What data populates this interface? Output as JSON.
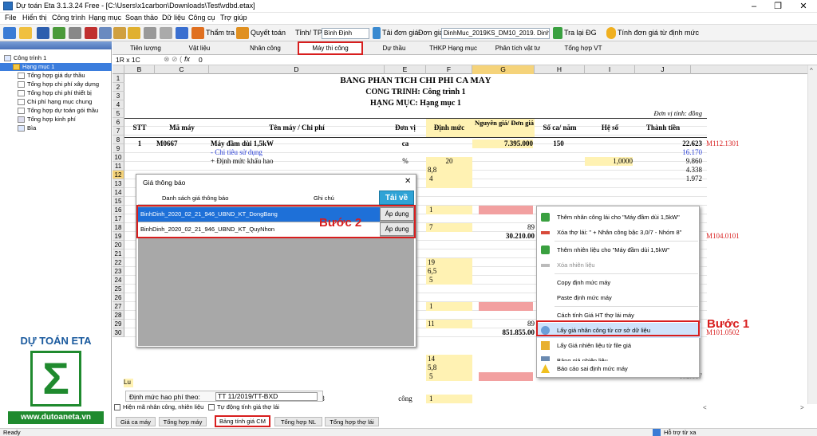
{
  "window": {
    "title": "Dự toán Eta 3.1.3.24 Free - [C:\\Users\\x1carbon\\Downloads\\Test\\vdbd.etax]",
    "min": "–",
    "max": "❐",
    "close": "✕"
  },
  "menu": [
    "File",
    "Hiển thị",
    "Công trình",
    "Hạng mục",
    "Soạn thảo",
    "Dữ liệu",
    "Công cụ",
    "Trợ giúp"
  ],
  "toolbar": {
    "tham_tra": "Thẩm tra",
    "quyet_toan": "Quyết toán",
    "tinh_label": "Tỉnh/ TP:",
    "tinh_value": "Bình Định",
    "tai_don_gia": "Tải đơn giá",
    "don_gia_label": "Đơn giá:",
    "don_gia_value": "DinhMuc_2019KS_DM10_2019. DinhMuc",
    "tra_lai_dg": "Tra lại ĐG",
    "tinh_don_gia": "Tính đơn giá từ định mức"
  },
  "sidebar": {
    "items": [
      "Công trình 1",
      "Hạng mục 1",
      "Tổng hợp giá dự thầu",
      "Tổng hợp chi phí xây dựng",
      "Tổng hợp chi phí thiết bị",
      "Chi phí hạng mục chung",
      "Tổng hợp dự toán gói thầu",
      "Tổng hợp kinh phí",
      "Bìa"
    ],
    "logo_top": "DỰ TOÁN ETA",
    "logo_bottom": "www.dutoaneta.vn",
    "logo_symbol": "Σ"
  },
  "tabs": [
    "Tiên lượng",
    "Vật liệu",
    "Nhân công",
    "Máy thi công",
    "Dự thầu",
    "THKP Hạng mục",
    "Phân tích vật tư",
    "Tổng hợp VT"
  ],
  "formula": {
    "cellref": "1R x 1C",
    "fx": "fx",
    "value": "0"
  },
  "columns": [
    "B",
    "C",
    "D",
    "E",
    "F",
    "G",
    "H",
    "I",
    "J"
  ],
  "rows": [
    "1",
    "2",
    "3",
    "4",
    "5",
    "6",
    "7",
    "8",
    "9",
    "10",
    "11",
    "12",
    "13",
    "14",
    "15",
    "16",
    "17",
    "18",
    "19",
    "20",
    "21",
    "22",
    "23",
    "24",
    "25",
    "26",
    "27",
    "28",
    "29",
    "30"
  ],
  "sheet": {
    "title": "BẢNG PHÂN TÍCH CHI PHÍ CA MÁY",
    "subtitle1": "CÔNG TRÌNH: Công trình 1",
    "subtitle2": "HẠNG MỤC: Hạng mục 1",
    "unit": "Đơn vị tính: đồng",
    "headers": {
      "stt": "STT",
      "ma": "Mã máy",
      "ten": "Tên máy / Chi phí",
      "dv": "Đơn vị",
      "dm": "Định mức",
      "ng": "Nguyên giá/ Đơn giá",
      "sc": "Số ca/ năm",
      "hs": "Hệ số",
      "tt": "Thành tiền"
    },
    "r6": {
      "stt": "1",
      "ma": "M0667",
      "ten": "Máy đầm dùi 1,5kW",
      "dv": "ca",
      "ng": "7.395.000",
      "sc": "150",
      "tt": "22.623",
      "note": "M112.1301"
    },
    "r7": {
      "ten": "- Chi tiêu sử dụng",
      "tt": "16.170"
    },
    "r8": {
      "ten": "+ Định mức khấu hao",
      "dv": "%",
      "dm": "20",
      "hs": "1,0000",
      "tt": "9.860"
    },
    "r9": {
      "dm": "8,8",
      "tt": "4.338"
    },
    "r10": {
      "dm": "4",
      "tt": "1.972"
    },
    "r12": {
      "dm": "1"
    },
    "r14": {
      "dm": "7",
      "ng": "89"
    },
    "r15": {
      "ng": "30.210.00",
      "tt": "4",
      "note": "M104.0101"
    },
    "r17": {
      "dm": "19"
    },
    "r18": {
      "dm": "6,5"
    },
    "r19": {
      "dm": "5"
    },
    "r21": {
      "dm": "1"
    },
    "r23": {
      "dm": "11",
      "ng": "89"
    },
    "r24": {
      "ng": "851.855.00",
      "tt": "0",
      "note": "M101.0502"
    },
    "r26": {
      "dm": "14"
    },
    "r27": {
      "dm": "5,8"
    },
    "r28": {
      "dm": "5",
      "tt": "152.117"
    },
    "r30": {
      "ten": "hóm 8",
      "dv": "công",
      "dm": "1"
    }
  },
  "dialog": {
    "title": "Giá thông báo",
    "close": "✕",
    "col1": "Danh sách giá thông báo",
    "col2": "Ghi chú",
    "reload": "Tải về",
    "rows": [
      {
        "name": "BinhDinh_2020_02_21_946_UBND_KT_DongBang",
        "btn": "Áp dụng"
      },
      {
        "name": "BinhDinh_2020_02_21_946_UBND_KT_QuyNhon",
        "btn": "Áp dụng"
      }
    ]
  },
  "steps": {
    "step1": "Bước 1",
    "step2": "Bước 2"
  },
  "context_menu": [
    "Thêm nhân công lái cho \"Máy đầm dùi 1,5kW\"",
    "Xóa thợ lái: \" + Nhân công bậc 3,0/7 - Nhóm 8\"",
    "Thêm nhiên liệu cho \"Máy đầm dùi 1,5kW\"",
    "Xóa nhiên liệu",
    "Copy định mức máy",
    "Paste định mức máy",
    "Cách tính Giá HT thợ lái máy",
    "Lấy giá nhân công từ cơ sở dữ liệu",
    "Lấy Giá nhiên liệu từ file giá",
    "Bảng giá nhiên liệu",
    "Báo cáo sai định mức máy"
  ],
  "bottom": {
    "lu": "Lu",
    "dinh_muc_label": "Định mức hao phí theo:",
    "dinh_muc_value": "TT 11/2019/TT-BXD",
    "cb1": "Hiện mã nhân công, nhiên liệu",
    "cb2": "Tự động tính giá thợ lái",
    "tabs": [
      "Giá ca máy",
      "Tổng hợp máy",
      "Bảng tính giá CM",
      "Tổng hợp NL",
      "Tổng hợp thợ lái"
    ]
  },
  "status": {
    "left": "Ready",
    "right": "Hỗ trợ từ xa"
  }
}
